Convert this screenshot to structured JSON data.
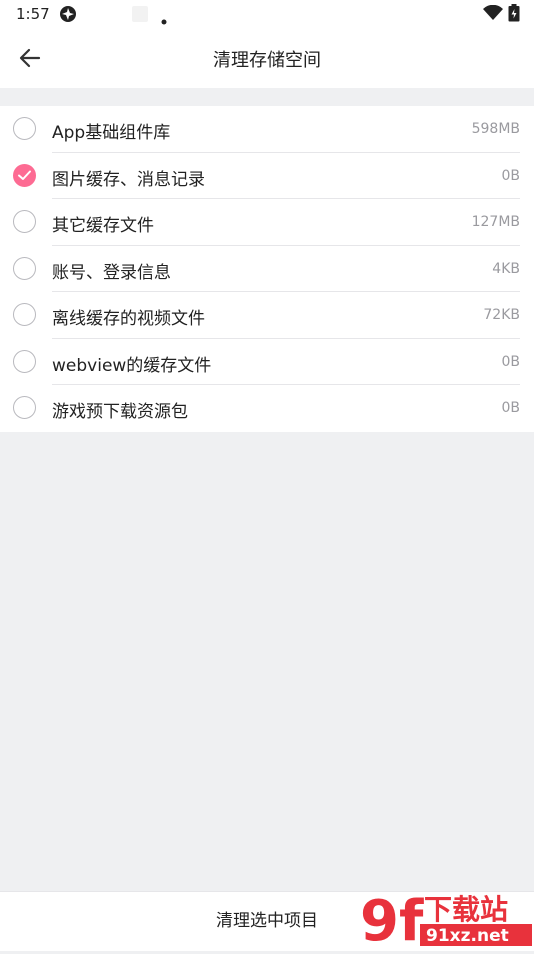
{
  "status_bar": {
    "time": "1:57",
    "icons": [
      "pinwheel-icon",
      "notification-square-icon",
      "dot-icon",
      "wifi-icon",
      "battery-icon"
    ]
  },
  "app_bar": {
    "back_icon": "arrow-left-icon",
    "title": "清理存储空间"
  },
  "items": [
    {
      "label": "App基础组件库",
      "size": "598MB",
      "checked": false
    },
    {
      "label": "图片缓存、消息记录",
      "size": "0B",
      "checked": true
    },
    {
      "label": "其它缓存文件",
      "size": "127MB",
      "checked": false
    },
    {
      "label": "账号、登录信息",
      "size": "4KB",
      "checked": false
    },
    {
      "label": "离线缓存的视频文件",
      "size": "72KB",
      "checked": false
    },
    {
      "label": "webview的缓存文件",
      "size": "0B",
      "checked": false
    },
    {
      "label": "游戏预下载资源包",
      "size": "0B",
      "checked": false
    }
  ],
  "bottom": {
    "clean_button": "清理选中项目"
  },
  "watermark": {
    "brand": "下载站",
    "site": "91xz.net",
    "logo": "9f"
  },
  "colors": {
    "accent": "#fd6b93",
    "background": "#eff0f2",
    "watermark_red": "#e8323c"
  }
}
